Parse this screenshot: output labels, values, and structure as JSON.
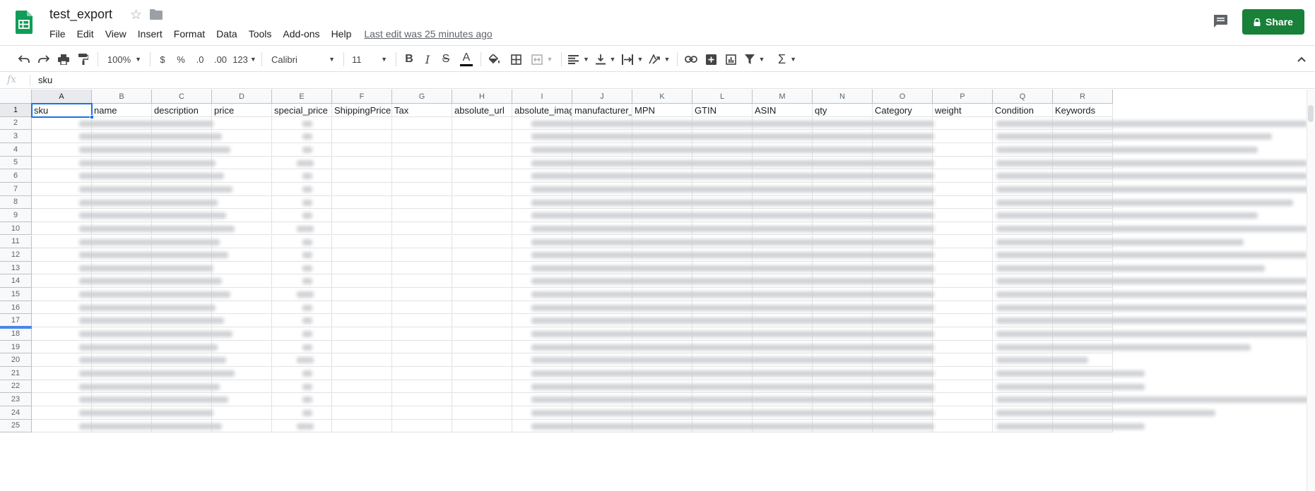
{
  "document": {
    "title": "test_export",
    "last_edit": "Last edit was 25 minutes ago"
  },
  "menu": [
    "File",
    "Edit",
    "View",
    "Insert",
    "Format",
    "Data",
    "Tools",
    "Add-ons",
    "Help"
  ],
  "share": {
    "label": "Share"
  },
  "toolbar": {
    "zoom": "100%",
    "currency": "$",
    "percent": "%",
    "decrease_decimals": ".0",
    "increase_decimals": ".00",
    "more_formats": "123",
    "font": "Calibri",
    "font_size": "11",
    "bold": "B",
    "italic": "I",
    "strikethrough": "S",
    "text_color": "A",
    "function": "Σ"
  },
  "formula_bar": {
    "fx": "fx",
    "content": "sku"
  },
  "columns": [
    "A",
    "B",
    "C",
    "D",
    "E",
    "F",
    "G",
    "H",
    "I",
    "J",
    "K",
    "L",
    "M",
    "N",
    "O",
    "P",
    "Q",
    "R"
  ],
  "header_row": [
    "sku",
    "name",
    "description",
    "price",
    "special_price",
    "ShippingPrice",
    "Tax",
    "absolute_url",
    "absolute_image_",
    "manufacturer_na",
    "MPN",
    "GTIN",
    "ASIN",
    "qty",
    "Category",
    "weight",
    "Condition",
    "Keywords"
  ],
  "row_numbers": [
    "1",
    "2",
    "3",
    "4",
    "5",
    "6",
    "7",
    "8",
    "9",
    "10",
    "11",
    "12",
    "13",
    "14",
    "15",
    "16",
    "17",
    "18",
    "19",
    "20",
    "21",
    "22",
    "23",
    "24",
    "25"
  ],
  "colors": {
    "share_green": "#188038",
    "selection_blue": "#1a73e8",
    "freeze_line": "#4a86e8",
    "sheets_green": "#0f9d58"
  }
}
